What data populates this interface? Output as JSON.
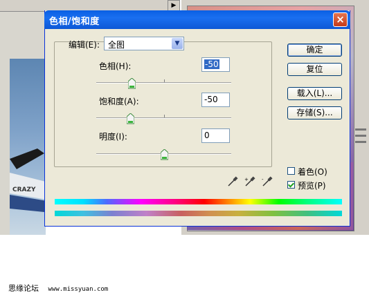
{
  "dialog": {
    "title": "色相/饱和度",
    "close_symbol": "×",
    "edit_label": "编辑(E):",
    "edit_value": "全图",
    "hue": {
      "label": "色相(H):",
      "value": "-50",
      "level": -50
    },
    "saturation": {
      "label": "饱和度(A):",
      "value": "-50",
      "level": -50
    },
    "lightness": {
      "label": "明度(I):",
      "value": "0",
      "level": 0
    },
    "buttons": {
      "ok": "确定",
      "reset": "复位",
      "load": "载入(L)...",
      "save": "存储(S)..."
    },
    "colorize": {
      "label": "着色(O)",
      "checked": false
    },
    "preview": {
      "label": "预览(P)",
      "checked": true
    }
  },
  "watermark": {
    "site": "思缘论坛",
    "url": "www.missyuan.com"
  },
  "colors": {
    "titlebar": "#0a5fe3",
    "dialog_bg": "#ece9d8"
  }
}
